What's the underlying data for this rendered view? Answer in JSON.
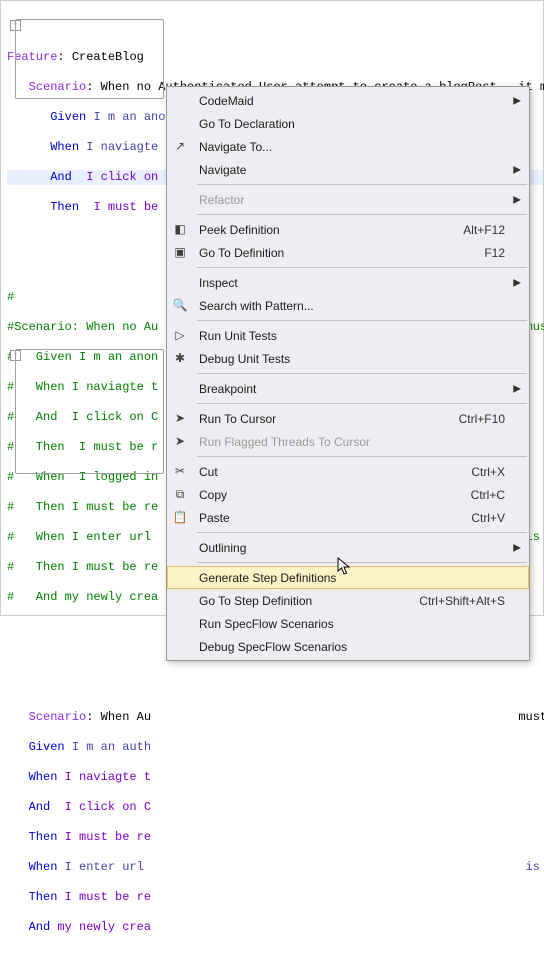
{
  "editor": {
    "feature_kw": "Feature",
    "feature_name": "CreateBlog",
    "scenario1_kw": "Scenario",
    "scenario1_name": "When no Authenticated User attempt to create a blogPost , it must b",
    "s1_given": "I m an anonymous user",
    "s1_when": "I naviagte to blog list page",
    "s1_and": "I click on C",
    "s1_then": "I must be r",
    "comment1_hash": "#",
    "comment2": "#Scenario: When no Au",
    "c_given": "#   Given I m an anon",
    "c_when": "#   When I naviagte t",
    "c_and": "#   And  I click on C",
    "c_then": "#   Then  I must be r",
    "c_when2": "#   When  I logged in",
    "c_then2": "#   Then I must be re",
    "c_when3": "#   When I enter url",
    "c_then3": "#   Then I must be re",
    "c_and2": "#   And my newly crea",
    "scenario2_kw": "Scenario",
    "scenario2_name": "When Au",
    "s2_given": "I m an auth",
    "s2_when": "I naviagte t",
    "s2_and": "I click on C",
    "s2_then": "I must be re",
    "s2_when2": "I enter url",
    "s2_then2": "I must be re",
    "s2_and2": "my newly crea",
    "kw_given": "Given",
    "kw_when": "When",
    "kw_and": "And",
    "kw_then": "Then",
    "tail_must": "must",
    "tail_issi": "is si",
    "tail_b": "must b"
  },
  "menu": {
    "items": [
      {
        "label": "CodeMaid",
        "arrow": true
      },
      {
        "label": "Go To Declaration"
      },
      {
        "label": "Navigate To...",
        "icon": "nav"
      },
      {
        "label": "Navigate",
        "arrow": true
      },
      {
        "sep": true
      },
      {
        "label": "Refactor",
        "arrow": true,
        "disabled": true
      },
      {
        "sep": true
      },
      {
        "label": "Peek Definition",
        "shortcut": "Alt+F12",
        "icon": "peek"
      },
      {
        "label": "Go To Definition",
        "shortcut": "F12",
        "icon": "goto"
      },
      {
        "sep": true
      },
      {
        "label": "Inspect",
        "arrow": true
      },
      {
        "label": "Search with Pattern...",
        "icon": "search"
      },
      {
        "sep": true
      },
      {
        "label": "Run Unit Tests",
        "icon": "run"
      },
      {
        "label": "Debug Unit Tests",
        "icon": "bug"
      },
      {
        "sep": true
      },
      {
        "label": "Breakpoint",
        "arrow": true
      },
      {
        "sep": true
      },
      {
        "label": "Run To Cursor",
        "shortcut": "Ctrl+F10",
        "icon": "runcursor"
      },
      {
        "label": "Run Flagged Threads To Cursor",
        "disabled": true,
        "icon": "runcursor"
      },
      {
        "sep": true
      },
      {
        "label": "Cut",
        "shortcut": "Ctrl+X",
        "icon": "cut"
      },
      {
        "label": "Copy",
        "shortcut": "Ctrl+C",
        "icon": "copy"
      },
      {
        "label": "Paste",
        "shortcut": "Ctrl+V",
        "icon": "paste"
      },
      {
        "sep": true
      },
      {
        "label": "Outlining",
        "arrow": true
      },
      {
        "sep": true
      },
      {
        "label": "Generate Step Definitions",
        "hover": true
      },
      {
        "label": "Go To Step Definition",
        "shortcut": "Ctrl+Shift+Alt+S"
      },
      {
        "label": "Run SpecFlow Scenarios"
      },
      {
        "label": "Debug SpecFlow Scenarios"
      }
    ]
  },
  "icons": {
    "nav": "↗",
    "peek": "◧",
    "goto": "▣",
    "search": "🔍",
    "run": "▷",
    "bug": "✱",
    "runcursor": "➤",
    "cut": "✂",
    "copy": "⧉",
    "paste": "📋"
  }
}
